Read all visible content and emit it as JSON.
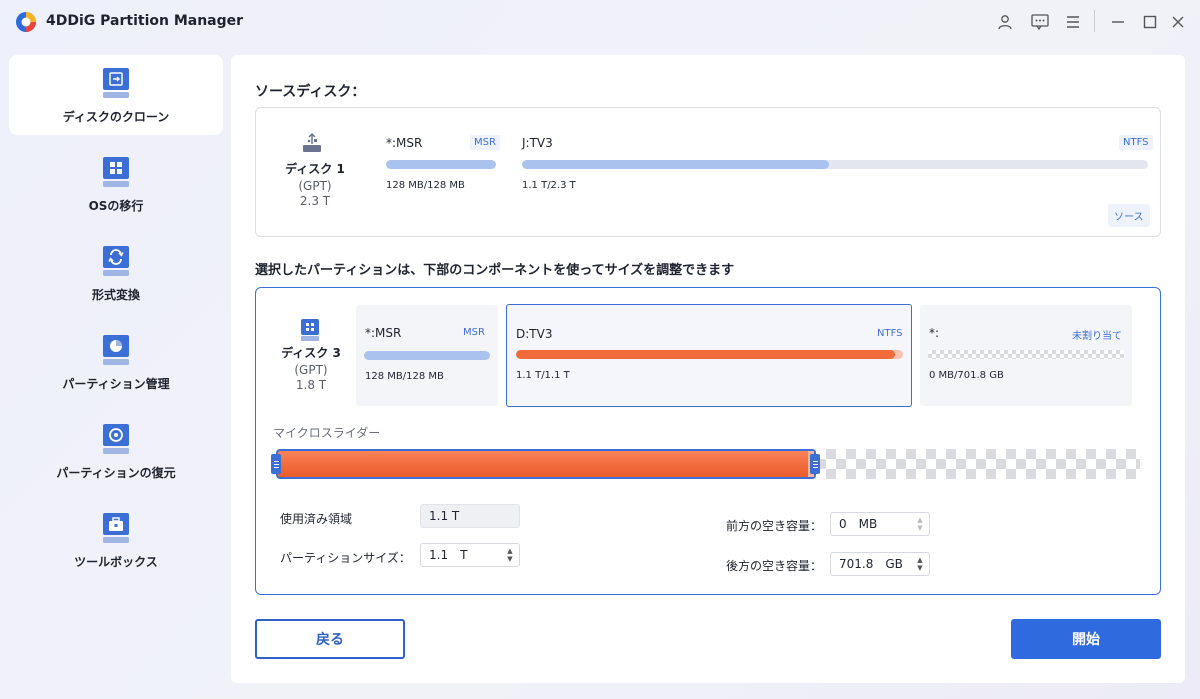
{
  "app": {
    "title": "4DDiG Partition Manager"
  },
  "sidebar": {
    "items": [
      {
        "label": "ディスクのクローン",
        "active": true
      },
      {
        "label": "OSの移行"
      },
      {
        "label": "形式変換"
      },
      {
        "label": "パーティション管理"
      },
      {
        "label": "パーティションの復元"
      },
      {
        "label": "ツールボックス"
      }
    ]
  },
  "source": {
    "title": "ソースディスク：",
    "disk": {
      "name": "ディスク 1",
      "type": "(GPT)",
      "size": "2.3 T"
    },
    "partitions": [
      {
        "name": "*:MSR",
        "tag": "MSR",
        "size": "128 MB/128 MB",
        "used_fraction": 1.0
      },
      {
        "name": "J:TV3",
        "tag": "NTFS",
        "size": "1.1 T/2.3 T",
        "used_fraction": 0.48
      }
    ],
    "badge": "ソース"
  },
  "target": {
    "title": "選択したパーティションは、下部のコンポーネントを使ってサイズを調整できます",
    "disk": {
      "name": "ディスク 3",
      "type": "(GPT)",
      "size": "1.8 T"
    },
    "partitions": [
      {
        "name": "*:MSR",
        "tag": "MSR",
        "size": "128 MB/128 MB",
        "used_fraction": 1.0
      },
      {
        "name": "D:TV3",
        "tag": "NTFS",
        "size": "1.1 T/1.1 T",
        "used_fraction": 0.99
      },
      {
        "name": "*:",
        "tag": "未割り当て",
        "size": "0 MB/701.8 GB",
        "used_fraction": 0
      }
    ],
    "slider_label": "マイクロスライダー",
    "slider_fraction": 0.62
  },
  "form": {
    "used_label": "使用済み領域",
    "used_value": "1.1 T",
    "partition_size_label": "パーティションサイズ：",
    "partition_size_value": "1.1",
    "partition_size_unit": "T",
    "front_free_label": "前方の空き容量：",
    "front_free_value": "0",
    "front_free_unit": "MB",
    "back_free_label": "後方の空き容量：",
    "back_free_value": "701.8",
    "back_free_unit": "GB"
  },
  "buttons": {
    "back": "戻る",
    "start": "開始"
  },
  "colors": {
    "accent": "#2f6bde",
    "used_orange": "#f06a3a",
    "bar_blue": "#a9c2ee"
  }
}
